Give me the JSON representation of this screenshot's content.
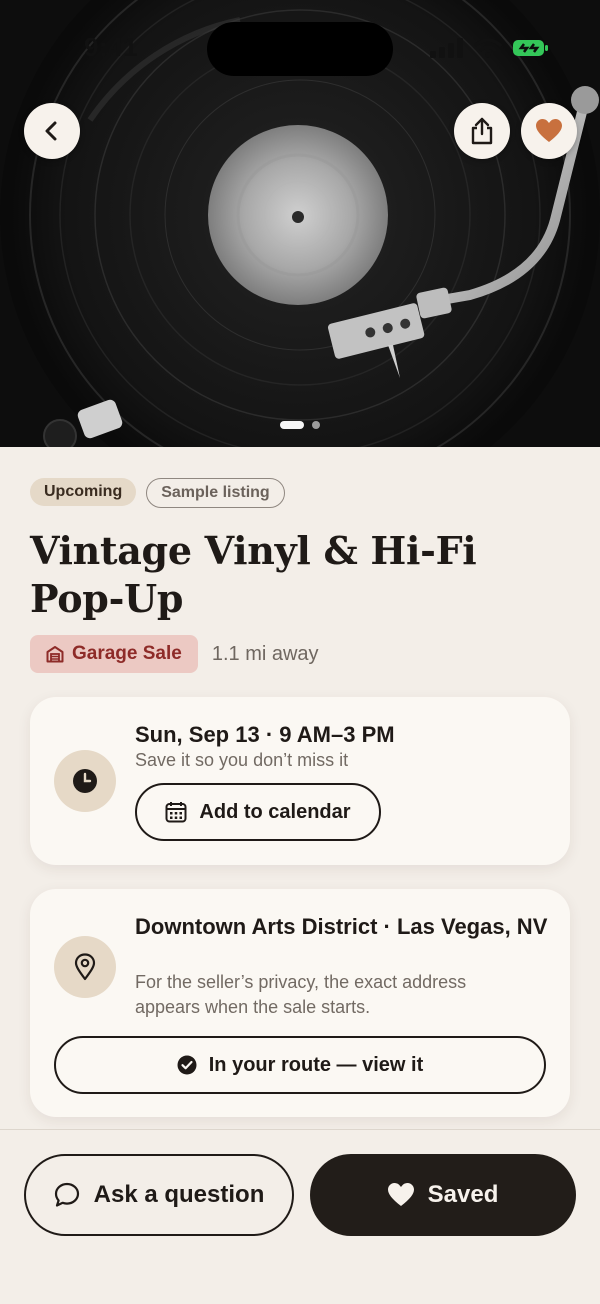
{
  "status_bar": {
    "time": "9:41"
  },
  "hero": {
    "photo_subject": "turntable-record-icon",
    "page_indicator": {
      "current": 1,
      "total": 2
    }
  },
  "header_actions": {
    "back_icon": "chevron-left-icon",
    "share_icon": "share-icon",
    "favorite_icon": "heart-icon"
  },
  "chips": {
    "status": "Upcoming",
    "sample": "Sample listing"
  },
  "listing": {
    "title": "Vintage Vinyl & Hi-Fi Pop-Up",
    "category": "Garage Sale",
    "category_icon": "garage-icon",
    "distance": "1.1 mi away"
  },
  "date_card": {
    "icon": "clock-icon",
    "heading": "Sun, Sep 13 · 9 AM–3 PM",
    "subtext": "Save it so you don’t miss it",
    "button_label": "Add to calendar",
    "button_icon": "calendar-icon"
  },
  "location_card": {
    "icon": "location-pin-icon",
    "heading": "Downtown Arts District · Las Vegas, NV",
    "subtext": "For the seller’s privacy, the exact address appears when the sale starts.",
    "button_label": "In your route — view it",
    "button_icon": "check-circle-icon"
  },
  "bottom_bar": {
    "ask_label": "Ask a question",
    "ask_icon": "chat-bubble-icon",
    "saved_label": "Saved",
    "saved_icon": "heart-icon"
  },
  "colors": {
    "background": "#f3eee8",
    "card": "#fbf8f3",
    "accent_heart": "#c8703e",
    "category_bg": "#ecc9c3",
    "category_text": "#8e2b28",
    "dark": "#221d19",
    "battery": "#34c759"
  }
}
